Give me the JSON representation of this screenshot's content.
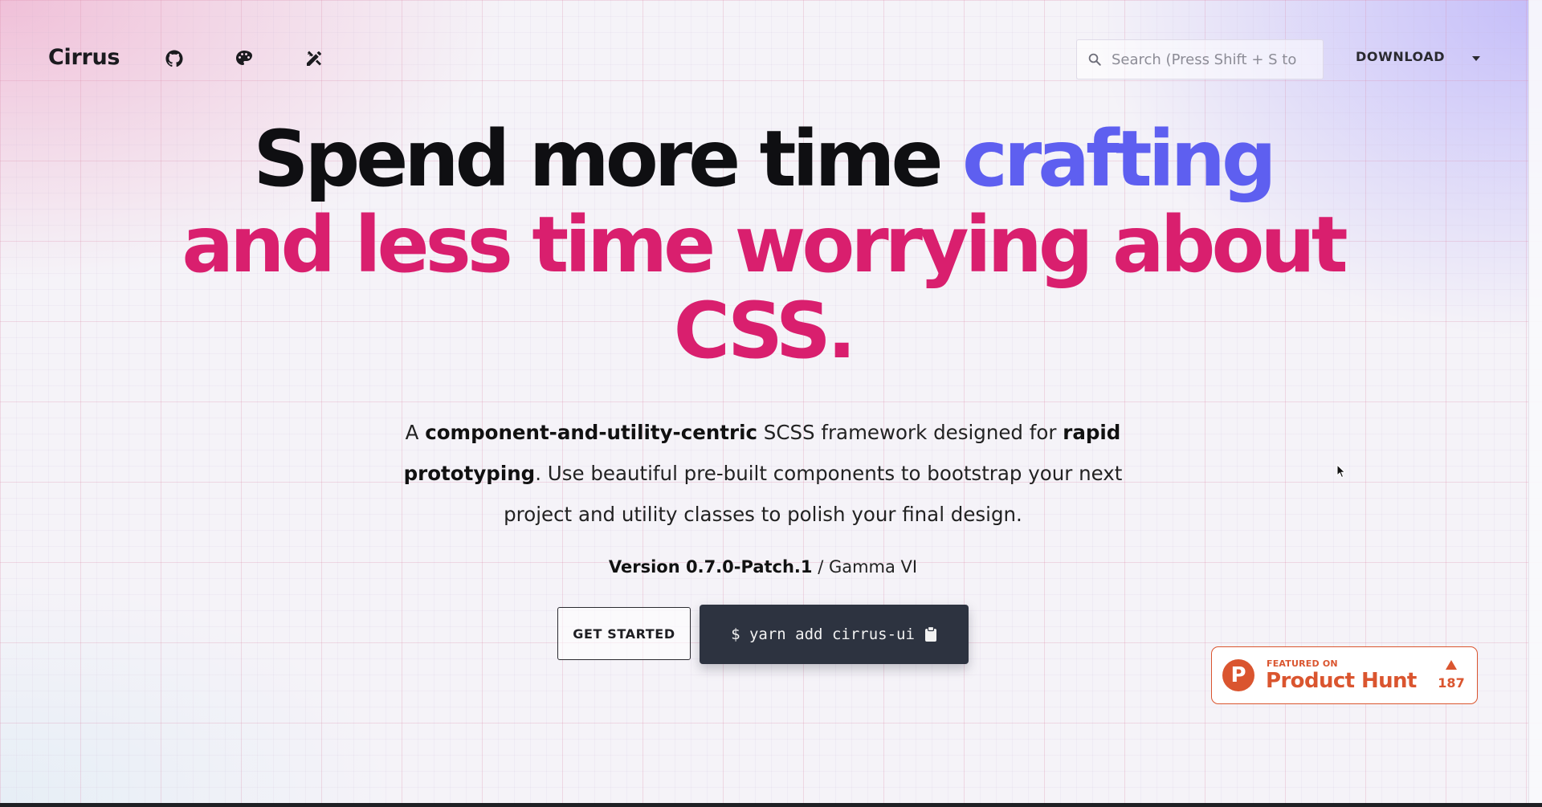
{
  "header": {
    "brand": "Cirrus",
    "icons": [
      "github-icon",
      "palette-icon",
      "design-tools-icon"
    ],
    "search_placeholder": "Search (Press Shift + S to",
    "download_label": "DOWNLOAD"
  },
  "hero": {
    "title_part1": "Spend more time ",
    "title_highlight1": "crafting",
    "title_part2": "and less time worrying about CSS.",
    "lead": {
      "t1": "A ",
      "b1": "component-and-utility-centric",
      "t2": " SCSS framework designed for ",
      "b2": "rapid prototyping",
      "t3": ". Use beautiful pre-built components to bootstrap your next project and utility classes to polish your final design."
    },
    "version_bold": "Version 0.7.0-Patch.1",
    "version_rest": " / Gamma VI"
  },
  "actions": {
    "get_started_label": "GET STARTED",
    "install_command": "$ yarn add cirrus-ui"
  },
  "product_hunt": {
    "logo_letter": "P",
    "featured_label": "FEATURED ON",
    "name": "Product Hunt",
    "votes": "187"
  },
  "colors": {
    "purple_accent": "#5e5ff0",
    "pink_accent": "#d91f6e",
    "product_hunt_orange": "#da552f",
    "dark_button": "#2d3340"
  }
}
